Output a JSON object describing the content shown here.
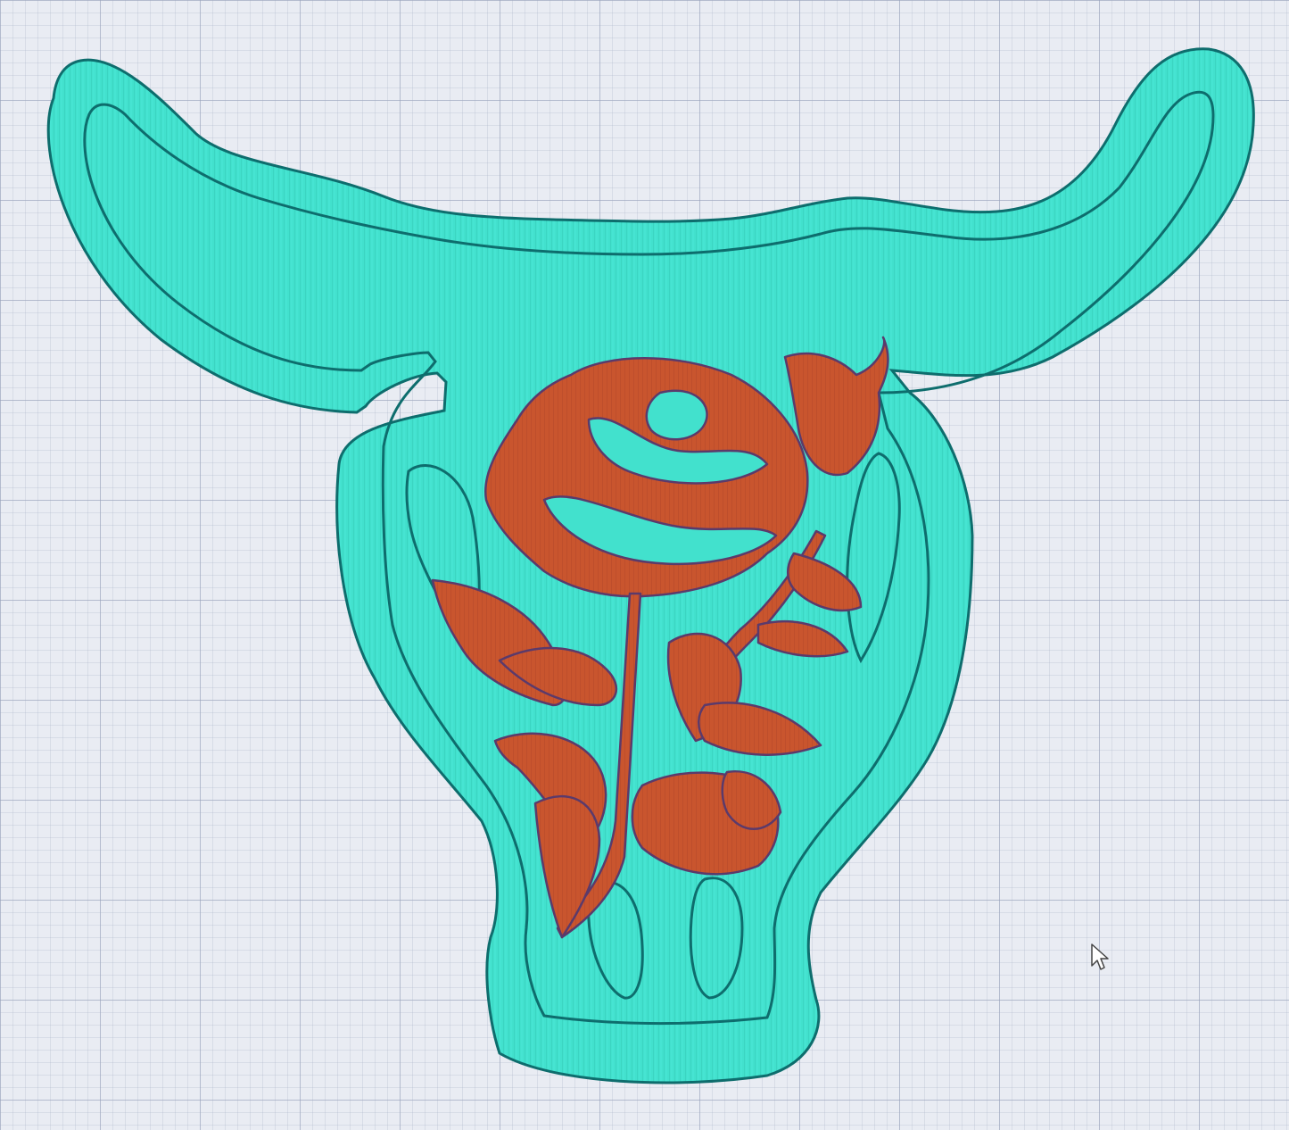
{
  "app": {
    "view": "design-canvas"
  },
  "canvas": {
    "background_color": "#e9ecf3",
    "grid_color": "#9aa2b9"
  },
  "design": {
    "shape": "bull-skull-with-rose",
    "layers": [
      {
        "name": "skull-outline-layer",
        "color": "#3fe0cc",
        "stroke": "#0e6f6f"
      },
      {
        "name": "rose-layer",
        "color": "#c8552f",
        "stroke": "#5a3a6e"
      }
    ]
  },
  "cursor": {
    "icon": "arrow-pointer-icon"
  }
}
